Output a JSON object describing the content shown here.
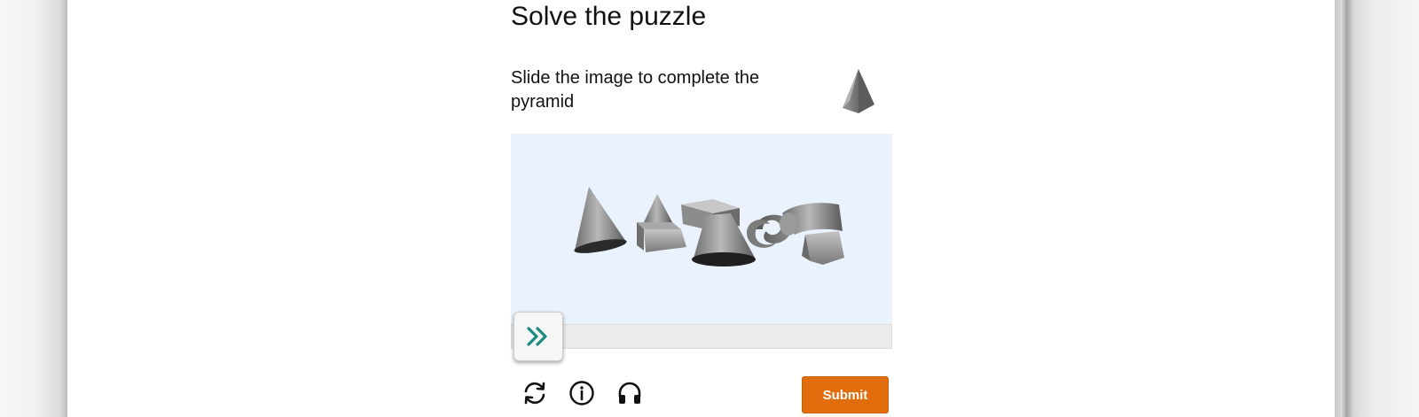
{
  "page": {
    "title": "Solve the puzzle",
    "instruction": "Slide the image to complete the pyramid"
  },
  "slider": {
    "position": 0
  },
  "icons": {
    "target": "pyramid-icon",
    "handle": "double-chevron-right-icon",
    "refresh": "refresh-icon",
    "info": "info-icon",
    "audio": "headphones-icon"
  },
  "actions": {
    "submit_label": "Submit"
  },
  "colors": {
    "accent": "#e16d0c",
    "puzzle_background": "#eaf3fd",
    "handle_chevron": "#1a8a82"
  }
}
